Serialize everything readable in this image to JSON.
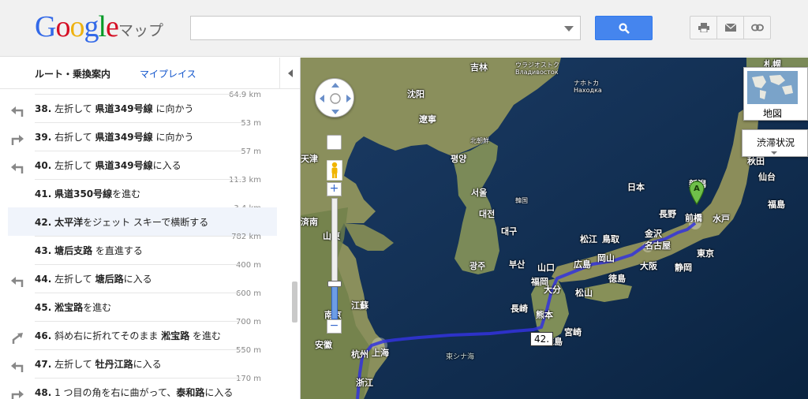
{
  "header": {
    "logo_letters": [
      {
        "ch": "G",
        "color": "#3369e8"
      },
      {
        "ch": "o",
        "color": "#d50f25"
      },
      {
        "ch": "o",
        "color": "#eeb211"
      },
      {
        "ch": "g",
        "color": "#3369e8"
      },
      {
        "ch": "l",
        "color": "#009925"
      },
      {
        "ch": "e",
        "color": "#d50f25"
      }
    ],
    "product": "マップ",
    "search": {
      "value": "",
      "placeholder": ""
    },
    "tools": [
      "print-icon",
      "mail-icon",
      "link-icon"
    ]
  },
  "sidebar": {
    "tab_route": "ルート・乗換案内",
    "tab_places": "マイプレイス",
    "steps": [
      {
        "dist_above": "64.9 km",
        "num": "38.",
        "pre": "左折して ",
        "bold": "県道349号線",
        "post": " に向かう",
        "turn": "left"
      },
      {
        "dist_above": "53 m",
        "num": "39.",
        "pre": "右折して ",
        "bold": "県道349号線",
        "post": " に向かう",
        "turn": "right"
      },
      {
        "dist_above": "57 m",
        "num": "40.",
        "pre": "左折して ",
        "bold": "県道349号線",
        "post": "に入る",
        "turn": "left"
      },
      {
        "dist_above": "11.3 km",
        "num": "41.",
        "pre": "",
        "bold": "県道350号線",
        "post": "を進む",
        "turn": "none"
      },
      {
        "dist_above": "3.4 km",
        "num": "42.",
        "pre": "",
        "bold": "太平洋",
        "post": "をジェット スキーで横断する",
        "turn": "none"
      },
      {
        "dist_above": "782 km",
        "num": "43.",
        "pre": "",
        "bold": "塘后支路",
        "post": " を直進する",
        "turn": "none"
      },
      {
        "dist_above": "400 m",
        "num": "44.",
        "pre": "左折して ",
        "bold": "塘后路",
        "post": "に入る",
        "turn": "left"
      },
      {
        "dist_above": "600 m",
        "num": "45.",
        "pre": "",
        "bold": "淞宝路",
        "post": "を進む",
        "turn": "none"
      },
      {
        "dist_above": "700 m",
        "num": "46.",
        "pre": "斜め右に折れてそのまま ",
        "bold": "淞宝路",
        "post": " を進む",
        "turn": "slight-right"
      },
      {
        "dist_above": "550 m",
        "num": "47.",
        "pre": "左折して ",
        "bold": "牡丹江路",
        "post": "に入る",
        "turn": "left"
      },
      {
        "dist_above": "170 m",
        "num": "48.",
        "pre": "1 つ目の角を右に曲がって、",
        "bold": "泰和路",
        "post": "に入る",
        "turn": "right"
      }
    ]
  },
  "map": {
    "maptype_label": "地図",
    "traffic_label": "渋滞状況",
    "marker_label": "A",
    "route_number": "42.",
    "route_color": "#3333dd",
    "labels": [
      {
        "t": "吉林",
        "s": ""
      },
      {
        "t": "ウラジオストク",
        "s": "small"
      },
      {
        "t": "Владивосток",
        "s": "small"
      },
      {
        "t": "ナホトカ",
        "s": "small"
      },
      {
        "t": "Находка",
        "s": "small"
      },
      {
        "t": "札幌",
        "s": ""
      },
      {
        "t": "沈阳",
        "s": ""
      },
      {
        "t": "遼寧",
        "s": ""
      },
      {
        "t": "北朝鮮",
        "s": "small"
      },
      {
        "t": "평양",
        "s": ""
      },
      {
        "t": "서울",
        "s": ""
      },
      {
        "t": "韓国",
        "s": "small"
      },
      {
        "t": "대전",
        "s": ""
      },
      {
        "t": "대구",
        "s": ""
      },
      {
        "t": "광주",
        "s": ""
      },
      {
        "t": "부산",
        "s": ""
      },
      {
        "t": "日本",
        "s": ""
      },
      {
        "t": "盛岡",
        "s": ""
      },
      {
        "t": "秋田",
        "s": ""
      },
      {
        "t": "仙台",
        "s": ""
      },
      {
        "t": "新潟",
        "s": ""
      },
      {
        "t": "福島",
        "s": ""
      },
      {
        "t": "長野",
        "s": ""
      },
      {
        "t": "前橋",
        "s": ""
      },
      {
        "t": "水戸",
        "s": ""
      },
      {
        "t": "金沢",
        "s": ""
      },
      {
        "t": "松江",
        "s": ""
      },
      {
        "t": "鳥取",
        "s": ""
      },
      {
        "t": "名古屋",
        "s": ""
      },
      {
        "t": "岡山",
        "s": ""
      },
      {
        "t": "東京",
        "s": ""
      },
      {
        "t": "広島",
        "s": ""
      },
      {
        "t": "大阪",
        "s": ""
      },
      {
        "t": "山口",
        "s": ""
      },
      {
        "t": "徳島",
        "s": ""
      },
      {
        "t": "静岡",
        "s": ""
      },
      {
        "t": "福岡",
        "s": ""
      },
      {
        "t": "大分",
        "s": ""
      },
      {
        "t": "松山",
        "s": ""
      },
      {
        "t": "長崎",
        "s": ""
      },
      {
        "t": "熊本",
        "s": ""
      },
      {
        "t": "宮崎",
        "s": ""
      },
      {
        "t": "済南",
        "s": ""
      },
      {
        "t": "山東",
        "s": ""
      },
      {
        "t": "江蘇",
        "s": ""
      },
      {
        "t": "南京",
        "s": ""
      },
      {
        "t": "上海",
        "s": ""
      },
      {
        "t": "安徽",
        "s": ""
      },
      {
        "t": "杭州",
        "s": ""
      },
      {
        "t": "浙江",
        "s": ""
      },
      {
        "t": "東シナ海",
        "s": "sea"
      },
      {
        "t": "天津",
        "s": ""
      },
      {
        "t": "鹿島",
        "s": ""
      }
    ]
  }
}
